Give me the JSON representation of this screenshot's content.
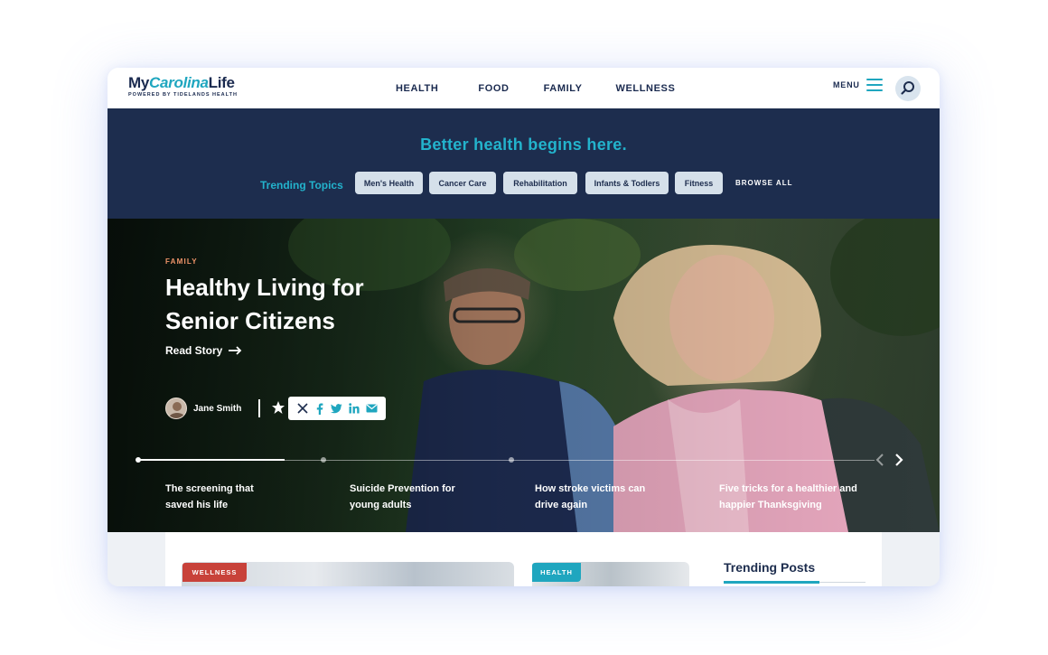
{
  "header": {
    "logo": {
      "part1": "My",
      "part2": "Carolina",
      "part3": "Life",
      "tagline": "POWERED BY TIDELANDS HEALTH"
    },
    "nav": [
      "HEALTH",
      "FOOD",
      "FAMILY",
      "WELLNESS"
    ],
    "menu_label": "MENU",
    "icons": {
      "menu": "hamburger-icon",
      "search": "search-icon"
    }
  },
  "banner": {
    "tagline": "Better health begins here.",
    "trending_label": "Trending Topics",
    "chips": [
      "Men's Health",
      "Cancer Care",
      "Rehabilitation",
      "Infants & Todlers",
      "Fitness"
    ],
    "browse_all": "BROWSE ALL"
  },
  "hero": {
    "category": "FAMILY",
    "title_line1": "Healthy Living for",
    "title_line2": "Senior Citizens",
    "read_story": "Read Story",
    "author": "Jane Smith",
    "share_icons": [
      "x-icon",
      "facebook-icon",
      "twitter-icon",
      "linkedin-icon",
      "email-icon"
    ],
    "slides": [
      {
        "line1": "The screening that",
        "line2": "saved his life"
      },
      {
        "line1": "Suicide Prevention for",
        "line2": "young adults"
      },
      {
        "line1": "How stroke victims can",
        "line2": "drive again"
      },
      {
        "line1": "Five tricks for a healthier and",
        "line2": "happier Thanksgiving"
      }
    ],
    "progress": 0.2
  },
  "content": {
    "cards": [
      {
        "badge": "WELLNESS",
        "badge_color": "#c8423a"
      },
      {
        "badge": "HEALTH",
        "badge_color": "#1fa6bf"
      }
    ],
    "trending_posts": "Trending Posts"
  },
  "colors": {
    "navy": "#1d2d4e",
    "teal": "#1fa6bf",
    "accent_orange": "#f0956a",
    "chip_bg": "#d5e0ea"
  }
}
